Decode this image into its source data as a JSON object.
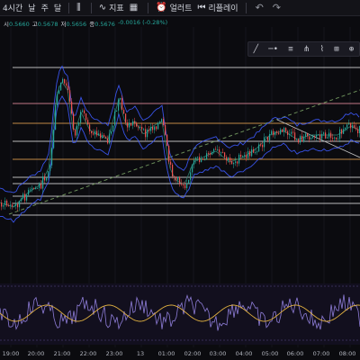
{
  "toolbar": {
    "interval": "4시간",
    "periods": [
      "날",
      "주",
      "달"
    ],
    "indicators_label": "지표",
    "alerts_label": "얼러트",
    "replay_label": "리플레이",
    "icons": [
      "chart-type-icon",
      "indicators-icon",
      "templates-icon",
      "alert-icon",
      "replay-icon",
      "undo-icon",
      "redo-icon"
    ]
  },
  "legend": {
    "open_label": "시",
    "open_value": "0.5660",
    "high_label": "고",
    "high_value": "0.5678",
    "low_label": "저",
    "low_value": "0.5656",
    "close_label": "종",
    "close_value": "0.5676",
    "change": "-0.0016 (-0.28%)"
  },
  "drawing_tools": [
    "trend-line-tool",
    "horizontal-line-tool",
    "fib-retracement-tool",
    "pitchfork-tool",
    "brush-tool",
    "measure-tool",
    "zoom-tool"
  ],
  "time_axis": [
    "19:00",
    "20:00",
    "21:00",
    "22:00",
    "23:00",
    "13",
    "01:00",
    "02:00",
    "03:00",
    "04:00",
    "05:00",
    "06:00",
    "07:00",
    "08:00"
  ],
  "colors": {
    "background": "#0b0b0f",
    "candle_up": "#26a69a",
    "candle_down": "#ef5350",
    "bollinger": "#3d5afe",
    "level_white": "#d9d9d9",
    "level_orange": "#e0a050",
    "level_pink": "#e08a9a",
    "trend_dashed": "#6b8e5a",
    "oscillator": "#8e7dd8",
    "oscillator_signal": "#e0b040"
  }
}
